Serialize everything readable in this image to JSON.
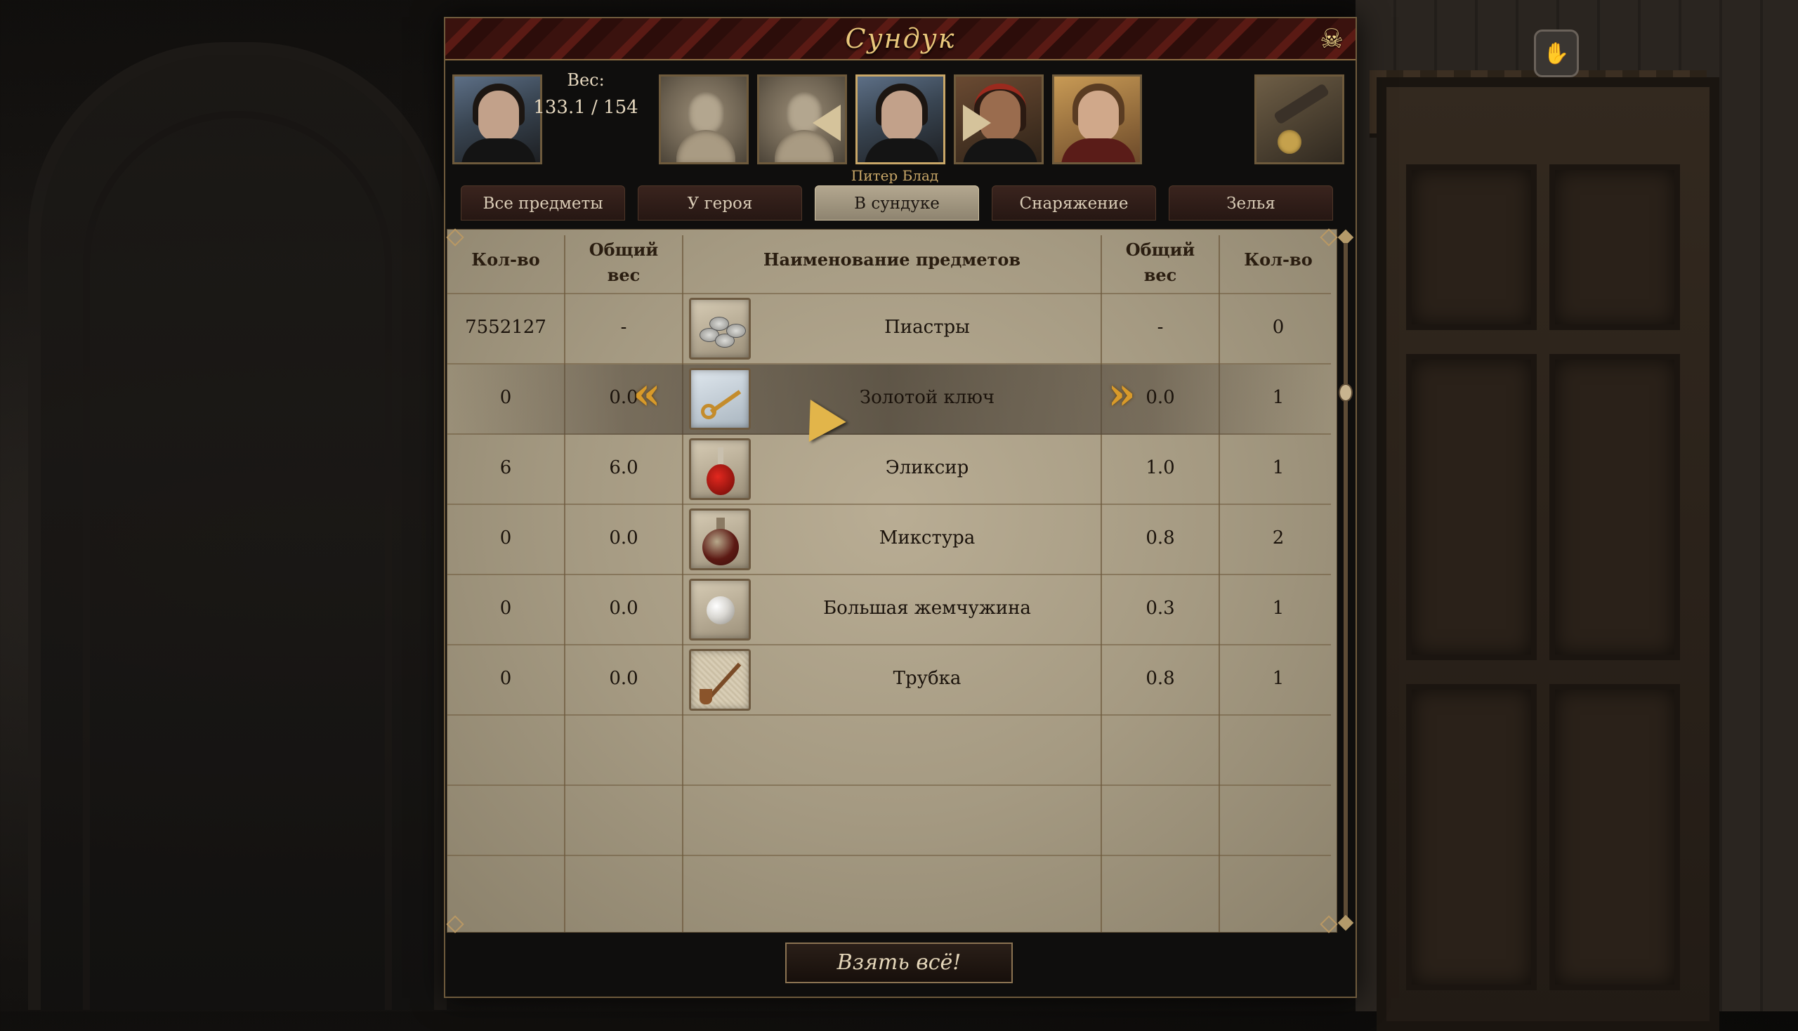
{
  "window": {
    "title": "Сундук",
    "close_icon": "skull-crossbones-icon"
  },
  "party": {
    "weight_label": "Вес:",
    "weight_value": "133.1 / 154",
    "selected_hero_name": "Питер Блад",
    "portraits": [
      "hero",
      "empty-slot",
      "empty-slot",
      "hero-selected",
      "native-companion",
      "blond-companion"
    ],
    "equipment_icon": "equipment-icon"
  },
  "tabs": [
    {
      "label": "Все предметы",
      "active": false
    },
    {
      "label": "У героя",
      "active": false
    },
    {
      "label": "В сундуке",
      "active": true
    },
    {
      "label": "Снаряжение",
      "active": false
    },
    {
      "label": "Зелья",
      "active": false
    }
  ],
  "table": {
    "headers": {
      "chest_qty": "Кол-во",
      "chest_weight_line1": "Общий",
      "chest_weight_line2": "вес",
      "name": "Наименование предметов",
      "hero_weight_line1": "Общий",
      "hero_weight_line2": "вес",
      "hero_qty": "Кол-во"
    },
    "rows": [
      {
        "chest_qty": "7552127",
        "chest_weight": "-",
        "icon": "coins-icon",
        "name": "Пиастры",
        "hero_weight": "-",
        "hero_qty": "0",
        "selected": false
      },
      {
        "chest_qty": "0",
        "chest_weight": "0.0",
        "icon": "golden-key-icon",
        "name": "Золотой ключ",
        "hero_weight": "0.0",
        "hero_qty": "1",
        "selected": true
      },
      {
        "chest_qty": "6",
        "chest_weight": "6.0",
        "icon": "elixir-icon",
        "name": "Эликсир",
        "hero_weight": "1.0",
        "hero_qty": "1",
        "selected": false
      },
      {
        "chest_qty": "0",
        "chest_weight": "0.0",
        "icon": "mixture-icon",
        "name": "Микстура",
        "hero_weight": "0.8",
        "hero_qty": "2",
        "selected": false
      },
      {
        "chest_qty": "0",
        "chest_weight": "0.0",
        "icon": "pearl-icon",
        "name": "Большая жемчужина",
        "hero_weight": "0.3",
        "hero_qty": "1",
        "selected": false
      },
      {
        "chest_qty": "0",
        "chest_weight": "0.0",
        "icon": "pipe-icon",
        "name": "Трубка",
        "hero_weight": "0.8",
        "hero_qty": "1",
        "selected": false
      }
    ]
  },
  "footer": {
    "take_all_label": "Взять всё!"
  },
  "colors": {
    "gold_accent": "#e9c77b",
    "selected_tab": "#b3a78f",
    "arrow_gold": "#d89a2a"
  }
}
